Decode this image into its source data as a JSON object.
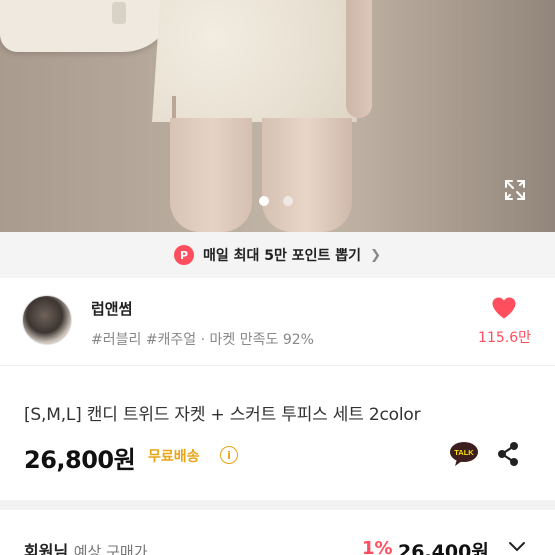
{
  "hero": {
    "slide_count": 2,
    "active_slide": 1
  },
  "banner": {
    "badge": "P",
    "text": "매일 최대 5만 포인트 뽑기",
    "chevron": "❯"
  },
  "seller": {
    "name": "럽앤썸",
    "meta": "#러블리 #캐주얼 · 마켓 만족도 92%",
    "like_count": "115.6만"
  },
  "product": {
    "title": "[S,M,L] 캔디 트위드 자켓 + 스커트 투피스 세트 2color",
    "price": "26,800원",
    "shipping": "무료배송",
    "info_glyph": "i"
  },
  "member": {
    "label": "회원님",
    "sublabel": "예상 구매가",
    "discount": "1%",
    "price": "26,400원"
  },
  "colors": {
    "accent": "#ff4f5e",
    "shipping": "#e8a516",
    "kakao_brown": "#3c1e1e"
  },
  "icons": {
    "expand": "expand-icon",
    "heart": "heart-icon",
    "talk": "kakaotalk-icon",
    "share": "share-icon",
    "chevron_down": "chevron-down-icon"
  }
}
